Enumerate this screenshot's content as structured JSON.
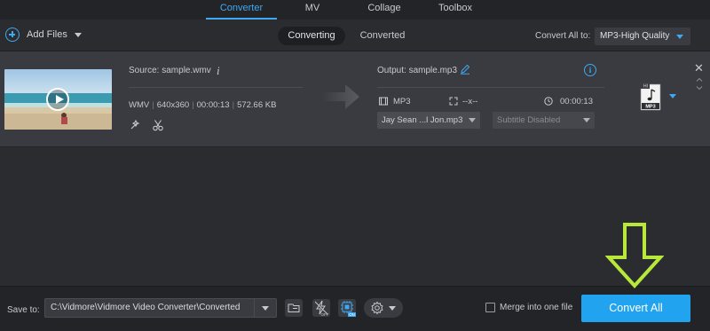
{
  "topnav": {
    "tabs": [
      {
        "label": "Converter",
        "active": true
      },
      {
        "label": "MV",
        "active": false
      },
      {
        "label": "Collage",
        "active": false
      },
      {
        "label": "Toolbox",
        "active": false
      }
    ]
  },
  "toolbar": {
    "add_files_label": "Add Files",
    "segments": [
      {
        "label": "Converting",
        "active": true
      },
      {
        "label": "Converted",
        "active": false
      }
    ],
    "convert_all_to_label": "Convert All to:",
    "format_selected": "MP3-High Quality"
  },
  "file": {
    "source_label": "Source: sample.wmv",
    "format": "WMV",
    "resolution": "640x360",
    "duration": "00:00:13",
    "size": "572.66 KB",
    "output_label": "Output: sample.mp3",
    "output_format": "MP3",
    "output_resolution": "--x--",
    "output_duration": "00:00:13",
    "audio_track": "Jay Sean ...l Jon.mp3",
    "subtitle": "Subtitle Disabled",
    "format_badge_top": "HI",
    "format_badge_bottom": "MP3"
  },
  "bottombar": {
    "save_to_label": "Save to:",
    "save_path": "C:\\Vidmore\\Vidmore Video Converter\\Converted",
    "merge_label": "Merge into one file",
    "convert_all_label": "Convert All",
    "hw_off_label": "OFF",
    "gpu_on_label": "ON"
  },
  "colors": {
    "accent": "#22a3f0",
    "tab_active": "#3fa8f0",
    "annotation_arrow": "#b8e83a"
  }
}
